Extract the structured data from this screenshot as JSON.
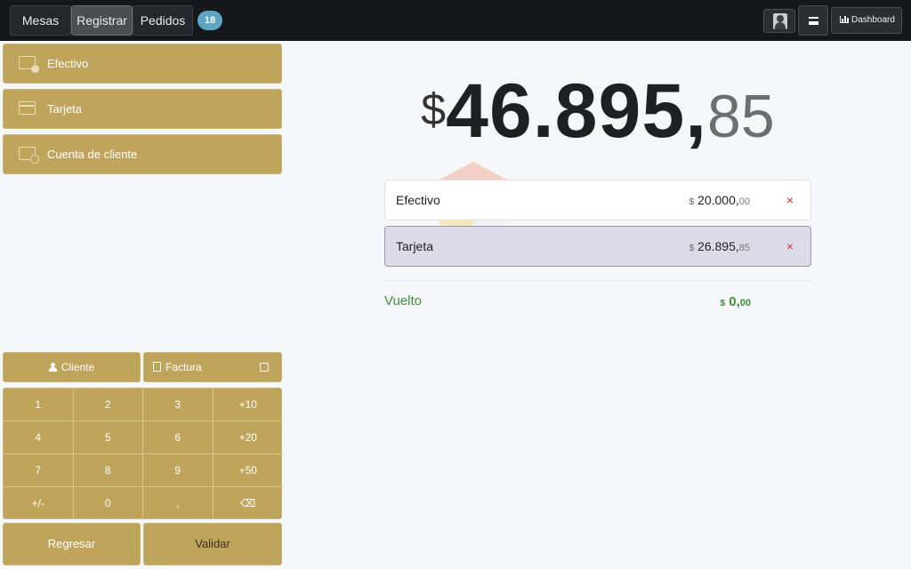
{
  "nav": {
    "tabs": [
      {
        "label": "Mesas"
      },
      {
        "label": "Registrar"
      },
      {
        "label": "Pedidos"
      }
    ],
    "orders_badge": "18",
    "dashboard_label": "Dashboard"
  },
  "payment_methods": [
    {
      "label": "Efectivo",
      "icon": "cash-icon"
    },
    {
      "label": "Tarjeta",
      "icon": "credit-card-icon"
    },
    {
      "label": "Cuenta de cliente",
      "icon": "customer-account-icon"
    }
  ],
  "options": {
    "client_label": "Cliente",
    "invoice_label": "Factura"
  },
  "numpad": {
    "keys": [
      "1",
      "2",
      "3",
      "+10",
      "4",
      "5",
      "6",
      "+20",
      "7",
      "8",
      "9",
      "+50",
      "+/-",
      "0",
      ",",
      "⌫"
    ]
  },
  "footer": {
    "back_label": "Regresar",
    "validate_label": "Validar"
  },
  "total": {
    "currency": "$",
    "integer": "46.895,",
    "decimals": "85"
  },
  "payment_lines": [
    {
      "method": "Efectivo",
      "currency": "$",
      "integer": "20.000,",
      "decimals": "00",
      "remove": "×",
      "selected": false
    },
    {
      "method": "Tarjeta",
      "currency": "$",
      "integer": "26.895,",
      "decimals": "85",
      "remove": "×",
      "selected": true
    }
  ],
  "change": {
    "label": "Vuelto",
    "currency": "$",
    "integer": "0,",
    "decimals": "00"
  },
  "colors": {
    "accent": "#bfa45c",
    "topbar": "#15171b",
    "badge": "#5ea4c3",
    "change_green": "#3f8f3a",
    "remove_red": "#cc3333",
    "selected_line": "#dedbe8"
  }
}
